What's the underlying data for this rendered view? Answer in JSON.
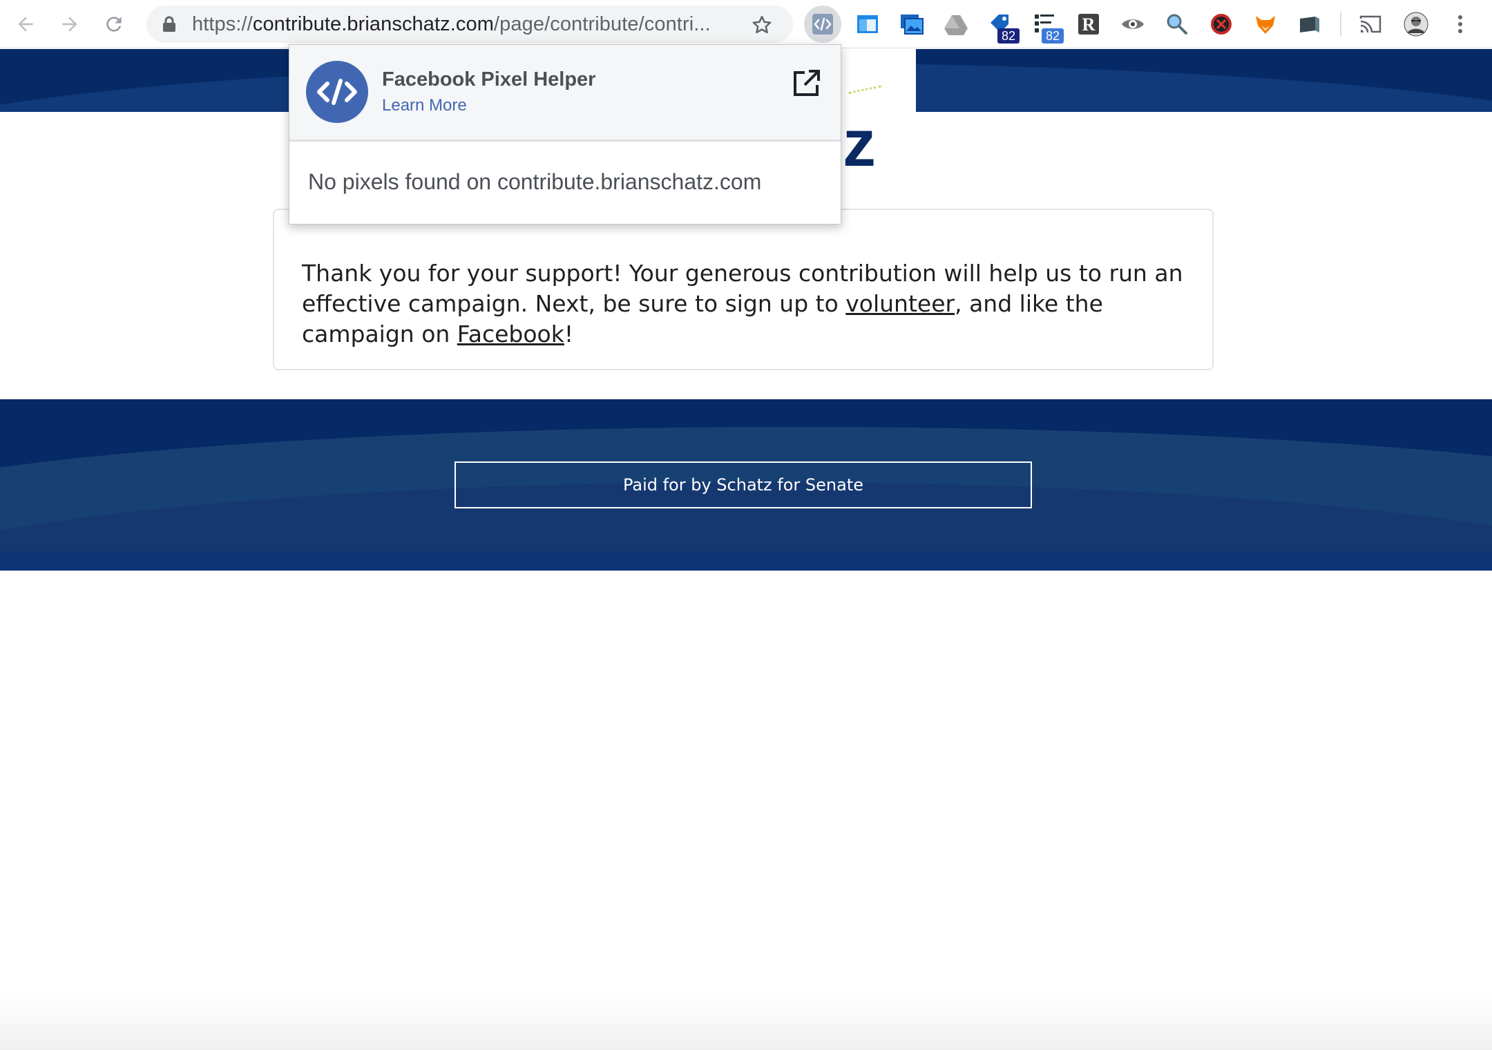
{
  "browser": {
    "url_prefix": "https://",
    "url_host": "contribute.brianschatz.com",
    "url_path": "/page/contribute/contri...",
    "extensions": [
      {
        "name": "pixel-helper-icon"
      },
      {
        "name": "window-icon"
      },
      {
        "name": "screenshot-icon"
      },
      {
        "name": "drive-icon"
      },
      {
        "name": "tag-icon",
        "badge": "82"
      },
      {
        "name": "datalayer-icon",
        "badge": "82"
      },
      {
        "name": "r-icon"
      },
      {
        "name": "eye-icon"
      },
      {
        "name": "search-magnifier-icon"
      },
      {
        "name": "blocker-icon"
      },
      {
        "name": "fox-icon"
      },
      {
        "name": "folder-icon"
      }
    ]
  },
  "popup": {
    "title": "Facebook Pixel Helper",
    "learn_more": "Learn More",
    "message": "No pixels found on contribute.brianschatz.com"
  },
  "page": {
    "logo_fragment": "z",
    "message_part1": "Thank you for your support! Your generous contribution will help us to run an effective campaign. Next, be sure to sign up to ",
    "volunteer_link": "volunteer",
    "message_part2": ", and like the campaign on ",
    "facebook_link": "Facebook",
    "message_part3": "!",
    "footer_disclaimer": "Paid for by Schatz for Senate"
  },
  "colors": {
    "brand_navy": "#062a66",
    "pixel_helper_blue": "#4267b2"
  }
}
